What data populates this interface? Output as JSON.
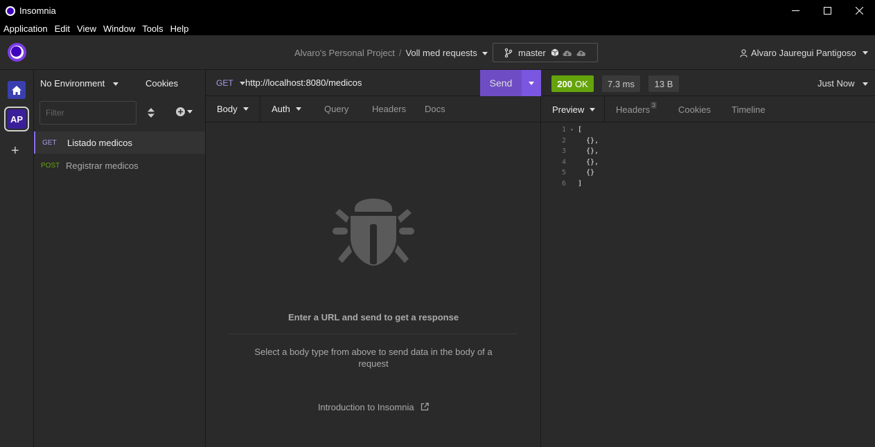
{
  "window": {
    "title": "Insomnia"
  },
  "menu": [
    "Application",
    "Edit",
    "View",
    "Window",
    "Tools",
    "Help"
  ],
  "header": {
    "project": "Alvaro's Personal Project",
    "separator": "/",
    "collection": "Voll med requests",
    "branch": "master",
    "user": "Alvaro Jauregui Pantigoso"
  },
  "rail": {
    "avatar": "AP",
    "add": "+"
  },
  "sidebar": {
    "environment": "No Environment",
    "cookies": "Cookies",
    "filter_placeholder": "Filter",
    "requests": [
      {
        "method": "GET",
        "name": "Listado medicos",
        "method_color": "#a89be8"
      },
      {
        "method": "POST",
        "name": "Registrar medicos",
        "method_color": "#65a30d"
      }
    ]
  },
  "request": {
    "method": "GET",
    "url": "http://localhost:8080/medicos",
    "send": "Send",
    "tabs": [
      "Body",
      "Auth",
      "Query",
      "Headers",
      "Docs"
    ],
    "empty_title": "Enter a URL and send to get a response",
    "empty_body": "Select a body type from above to send data in the body of a request",
    "intro_link": "Introduction to Insomnia"
  },
  "response": {
    "status_code": "200",
    "status_text": "OK",
    "time": "7.3 ms",
    "size": "13 B",
    "when": "Just Now",
    "tabs": [
      "Preview",
      "Headers",
      "Cookies",
      "Timeline"
    ],
    "headers_count": "3",
    "lines": [
      "[",
      "  {},",
      "  {},",
      "  {},",
      "  {}",
      "]"
    ],
    "line_numbers": [
      "1",
      "2",
      "3",
      "4",
      "5",
      "6"
    ]
  },
  "colors": {
    "accent": "#7b56e0",
    "ok": "#65a30d",
    "get": "#a89be8",
    "post": "#65a30d"
  }
}
